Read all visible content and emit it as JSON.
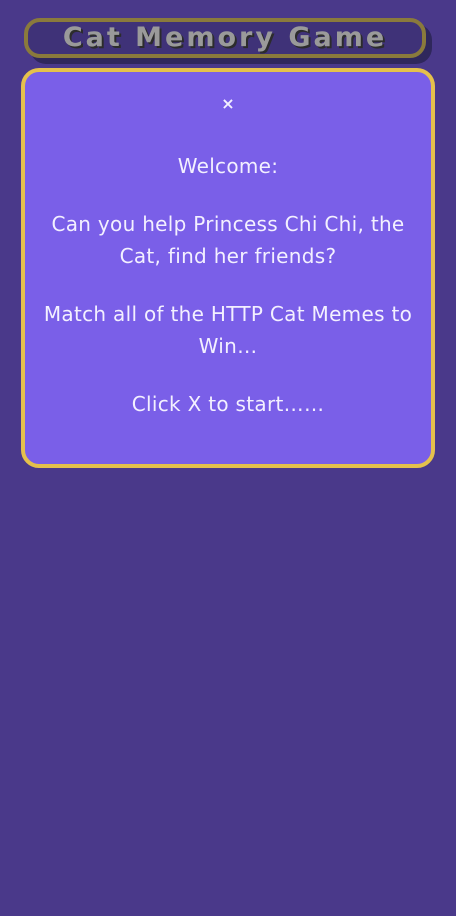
{
  "header": {
    "title": "Cat Memory Game"
  },
  "modal": {
    "close_glyph": "×",
    "welcome": "Welcome:",
    "line1": "Can you help Princess Chi Chi, the Cat, find her friends?",
    "line2": "Match all of the HTTP Cat Memes to Win…",
    "line3": "Click X to start……"
  },
  "colors": {
    "background": "#4a398a",
    "modal_bg": "#7a5fe8",
    "modal_border": "#e5c14c",
    "title_border": "#8a7a3c",
    "title_text": "#9a9a9a"
  }
}
